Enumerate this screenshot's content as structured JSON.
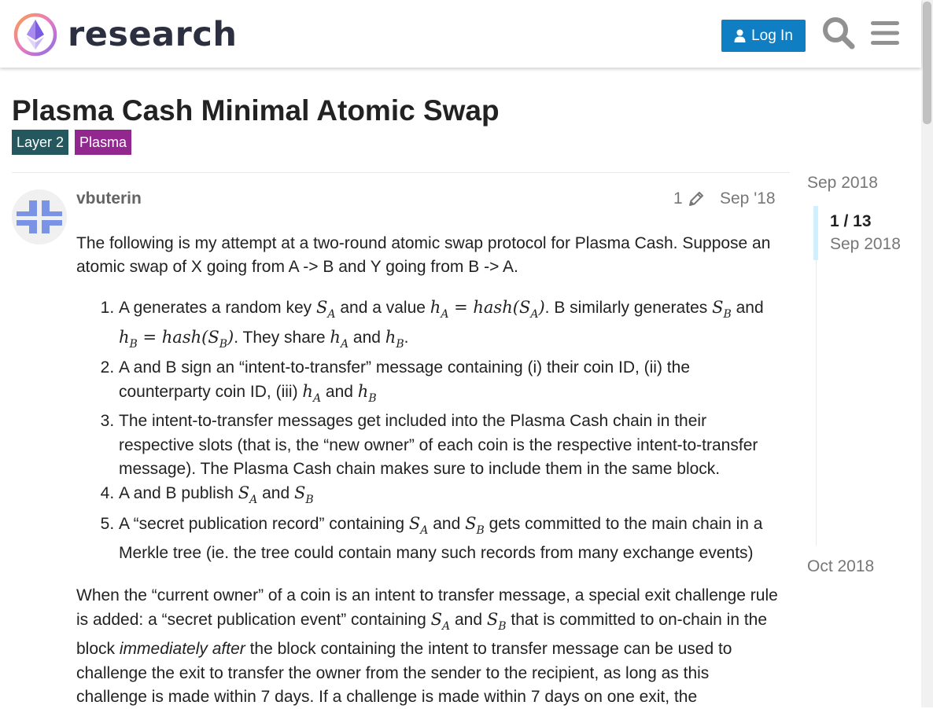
{
  "header": {
    "site_name": "research",
    "login_label": "Log In",
    "search_icon": "search-icon",
    "menu_icon": "hamburger-menu-icon"
  },
  "topic": {
    "title": "Plasma Cash Minimal Atomic Swap",
    "tags": [
      {
        "label": "Layer 2",
        "color": "#25585e"
      },
      {
        "label": "Plasma",
        "color": "#92278f"
      }
    ]
  },
  "post": {
    "username": "vbuterin",
    "edit_count": "1",
    "date": "Sep '18",
    "intro": "The following is my attempt at a two-round atomic swap protocol for Plasma Cash. Suppose an atomic swap of X going from A -> B and Y going from B -> A.",
    "steps": [
      {
        "t1": "A generates a random key ",
        "t2": " and a value ",
        "t3": ". B similarly generates ",
        "t4": " and ",
        "t5": ". They share ",
        "t6": " and ",
        "t7": "."
      },
      {
        "t1": "A and B sign an “intent-to-transfer” message containing (i) their coin ID, (ii) the counterparty coin ID, (iii) ",
        "t2": " and "
      },
      {
        "t1": "The intent-to-transfer messages get included into the Plasma Cash chain in their respective slots (that is, the “new owner” of each coin is the respective intent-to-transfer message). The Plasma Cash chain makes sure to include them in the same block."
      },
      {
        "t1": "A and B publish ",
        "t2": " and "
      },
      {
        "t1": "A “secret publication record” containing ",
        "t2": " and ",
        "t3": " gets committed to the main chain in a Merkle tree (ie. the tree could contain many such records from many exchange events)"
      }
    ],
    "para2": {
      "t1": "When the “current owner” of a coin is an intent to transfer message, a special exit challenge rule is added: a “secret publication event” containing ",
      "t2": " and ",
      "t3": " that is committed to on-chain in the block ",
      "em": "immediately after",
      "t4": " the block containing the intent to transfer message can be used to challenge the exit to transfer the owner from the sender to the recipient, as long as this challenge is made within 7 days. If a challenge is made within 7 days on one exit, the"
    },
    "math": {
      "S": "S",
      "h": "h",
      "hash": "hash",
      "eq": " = ",
      "lp": "(",
      "rp": ")",
      "A": "A",
      "B": "B"
    }
  },
  "timeline": {
    "start": "Sep 2018",
    "count": "1 / 13",
    "current_date": "Sep 2018",
    "end": "Oct 2018"
  },
  "colors": {
    "brand_blue": "#0f7ec3",
    "avatar_bg": "#f0f0f0",
    "avatar_fg": "#7b93e4",
    "timeline_handle": "#d1f0ff"
  }
}
